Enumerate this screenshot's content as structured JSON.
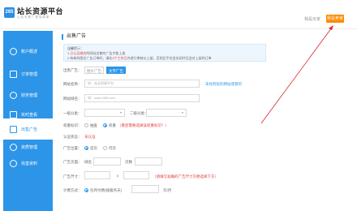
{
  "header": {
    "logo_badge": "265",
    "logo_title": "站长资源平台",
    "logo_sub": "让 站 长 推 广 更 加 简 单",
    "link1": "我是买家",
    "link2": "我是卖家",
    "button": "我是卖家"
  },
  "sidebar": {
    "items": [
      {
        "label": "账户概述",
        "icon": "account-icon"
      },
      {
        "label": "订单管理",
        "icon": "order-icon"
      },
      {
        "label": "财务管理",
        "icon": "finance-icon"
      },
      {
        "label": "实时查看",
        "icon": "realtime-icon"
      },
      {
        "label": "出售广告",
        "icon": "ad-icon"
      },
      {
        "label": "资质管理",
        "icon": "cert-icon"
      },
      {
        "label": "完善资料",
        "icon": "profile-icon"
      }
    ]
  },
  "main": {
    "title": "出售广告",
    "notice_title": "温馨提示：",
    "notice_line1_pre": "1.",
    "notice_line1_hl": "已认证域名",
    "notice_line1_post": "的网站出售的广告才能上架",
    "notice_line2_pre": "2.有新的图文广告订单时，请在",
    "notice_line2_hl": "3个工作日",
    "notice_line2_post": "内进行审核以上架，否则后平台会关闭并且会对上架的订单",
    "sell_label": "出售广告：",
    "tab1": "图片广告",
    "tab2": "文字广告",
    "site_name_label": "网站名称：",
    "site_name_placeholder": "如：站长资源平台",
    "site_name_link": "未找到您的网站或者的",
    "site_domain_label": "网站域名：",
    "site_domain_placeholder": "如：www.265l.com",
    "cat1_label": "一级分类：",
    "cat2_label": "二级分类：",
    "weight_label": "权重标识：",
    "weight_opt1": "抽查",
    "weight_opt2": "权重",
    "weight_note": "（看您需要选择该权重标识！）",
    "auth_label": "认证状态：",
    "auth_value": "未认证",
    "pos_label": "广告位置：",
    "pos_opt1": "首页",
    "pos_opt2": "内页",
    "page_label": "广告页面：",
    "page_domain": "域名",
    "page_count": "页数",
    "size_label": "广告尺寸：",
    "size_x": "x",
    "size_note": "（请填写准确的广告尺寸方便选择下方）",
    "price_label": "计费方式：",
    "price_opt": "包月付费(按服务天)",
    "price_unit": "元/月"
  },
  "colors": {
    "brand": "#2d95e8",
    "accent": "#ff8a00",
    "warn": "#e53935"
  }
}
